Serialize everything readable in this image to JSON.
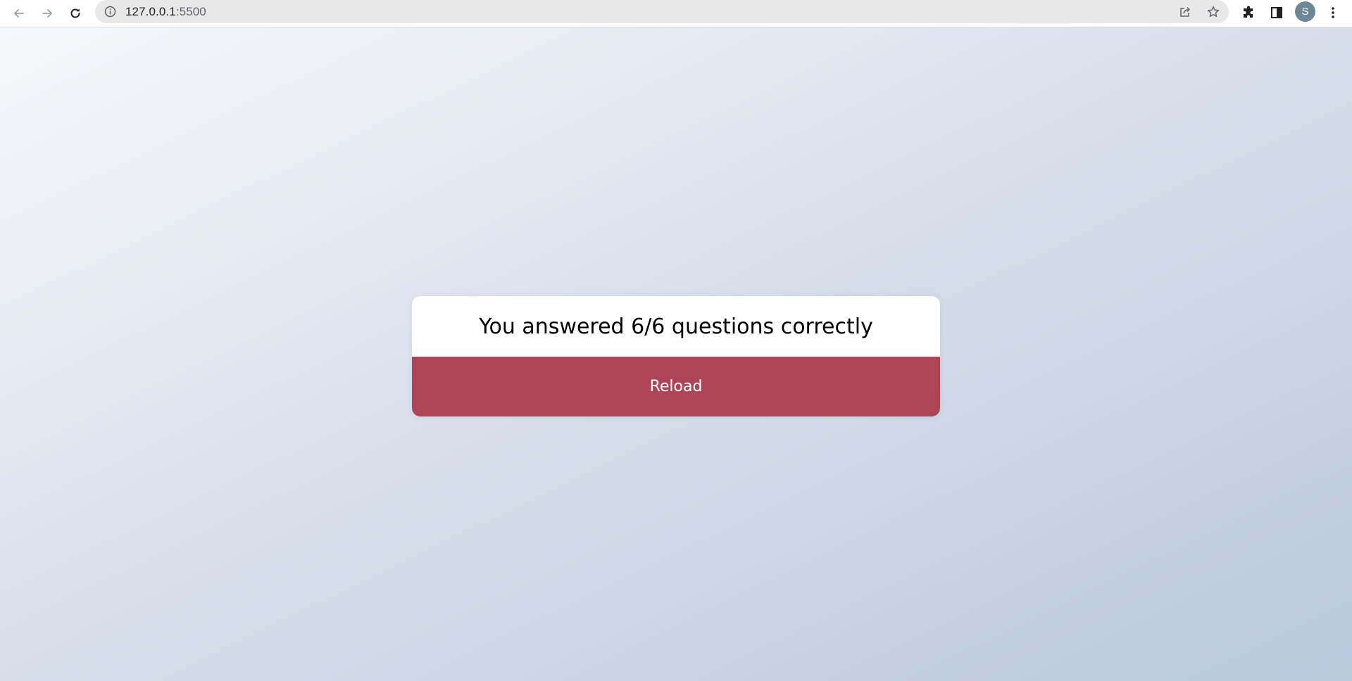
{
  "browser": {
    "url_host": "127.0.0.1",
    "url_port": ":5500",
    "profile_initial": "S"
  },
  "quiz": {
    "result_text": "You answered 6/6 questions correctly",
    "reload_label": "Reload"
  },
  "colors": {
    "reload_button": "#ad4458",
    "card_background": "#ffffff"
  }
}
